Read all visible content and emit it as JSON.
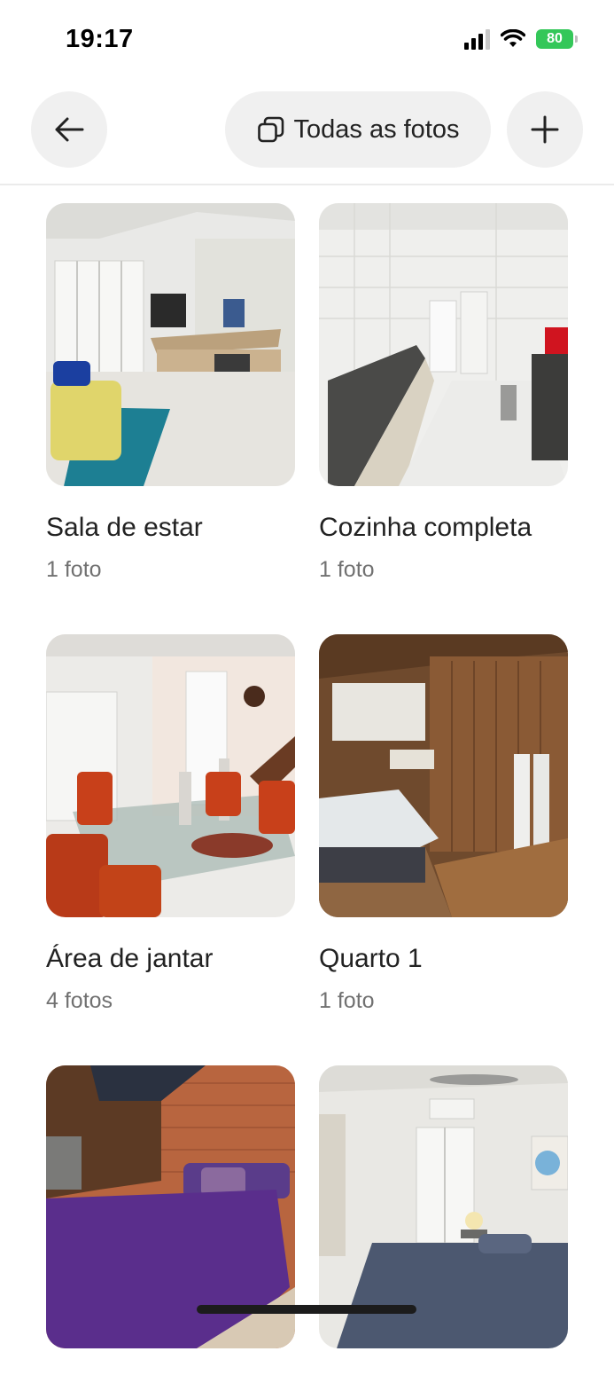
{
  "status_bar": {
    "time": "19:17",
    "battery": "80"
  },
  "nav": {
    "all_photos_label": "Todas as fotos"
  },
  "rooms": [
    {
      "title": "Sala de estar",
      "count": "1 foto"
    },
    {
      "title": "Cozinha completa",
      "count": "1 foto"
    },
    {
      "title": "Área de jantar",
      "count": "4 fotos"
    },
    {
      "title": "Quarto 1",
      "count": "1 foto"
    },
    {
      "title": "",
      "count": ""
    },
    {
      "title": "",
      "count": ""
    }
  ],
  "colors": {
    "accent_green": "#34c759",
    "button_bg": "#f0f0f0",
    "text_primary": "#222222",
    "text_secondary": "#717171"
  },
  "icons": [
    "back-arrow-icon",
    "photo-stack-icon",
    "plus-icon",
    "signal-icon",
    "wifi-icon",
    "battery-icon"
  ]
}
